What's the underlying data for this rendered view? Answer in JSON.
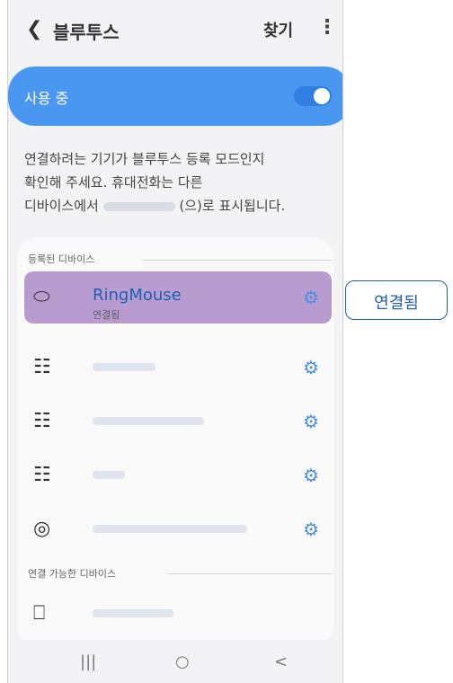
{
  "header": {
    "back_icon": "back-arrow",
    "title": "블루투스",
    "find_label": "찾기",
    "more_icon": "more-vert"
  },
  "toggle": {
    "label": "사용 중",
    "on": true,
    "accent_color": "#4a97f2"
  },
  "description": {
    "line1": "연결하려는 기기가 블루투스 등록 모드인지",
    "line2": "확인해 주세요. 휴대전화는 다른",
    "line3_prefix": "디바이스에서",
    "line3_suffix": "(으)로 표시됩니다."
  },
  "paired": {
    "header": "등록된 디바이스",
    "devices": [
      {
        "name": "RingMouse",
        "status": "연결됨",
        "icon": "mouse-icon",
        "highlighted": true
      },
      {
        "name": "",
        "icon": "device-grid-icon"
      },
      {
        "name": "",
        "icon": "device-grid-icon"
      },
      {
        "name": "",
        "icon": "device-grid-icon"
      },
      {
        "name": "",
        "icon": "earbuds-icon"
      }
    ]
  },
  "available": {
    "header": "연결 가능한 디바이스",
    "devices": [
      {
        "name": "",
        "icon": "laptop-phone-icon"
      }
    ]
  },
  "navbar": {
    "recent": "|||",
    "home": "○",
    "back": "<"
  },
  "annotation": {
    "text": "연결됨",
    "border_color": "#1e5fb5"
  }
}
